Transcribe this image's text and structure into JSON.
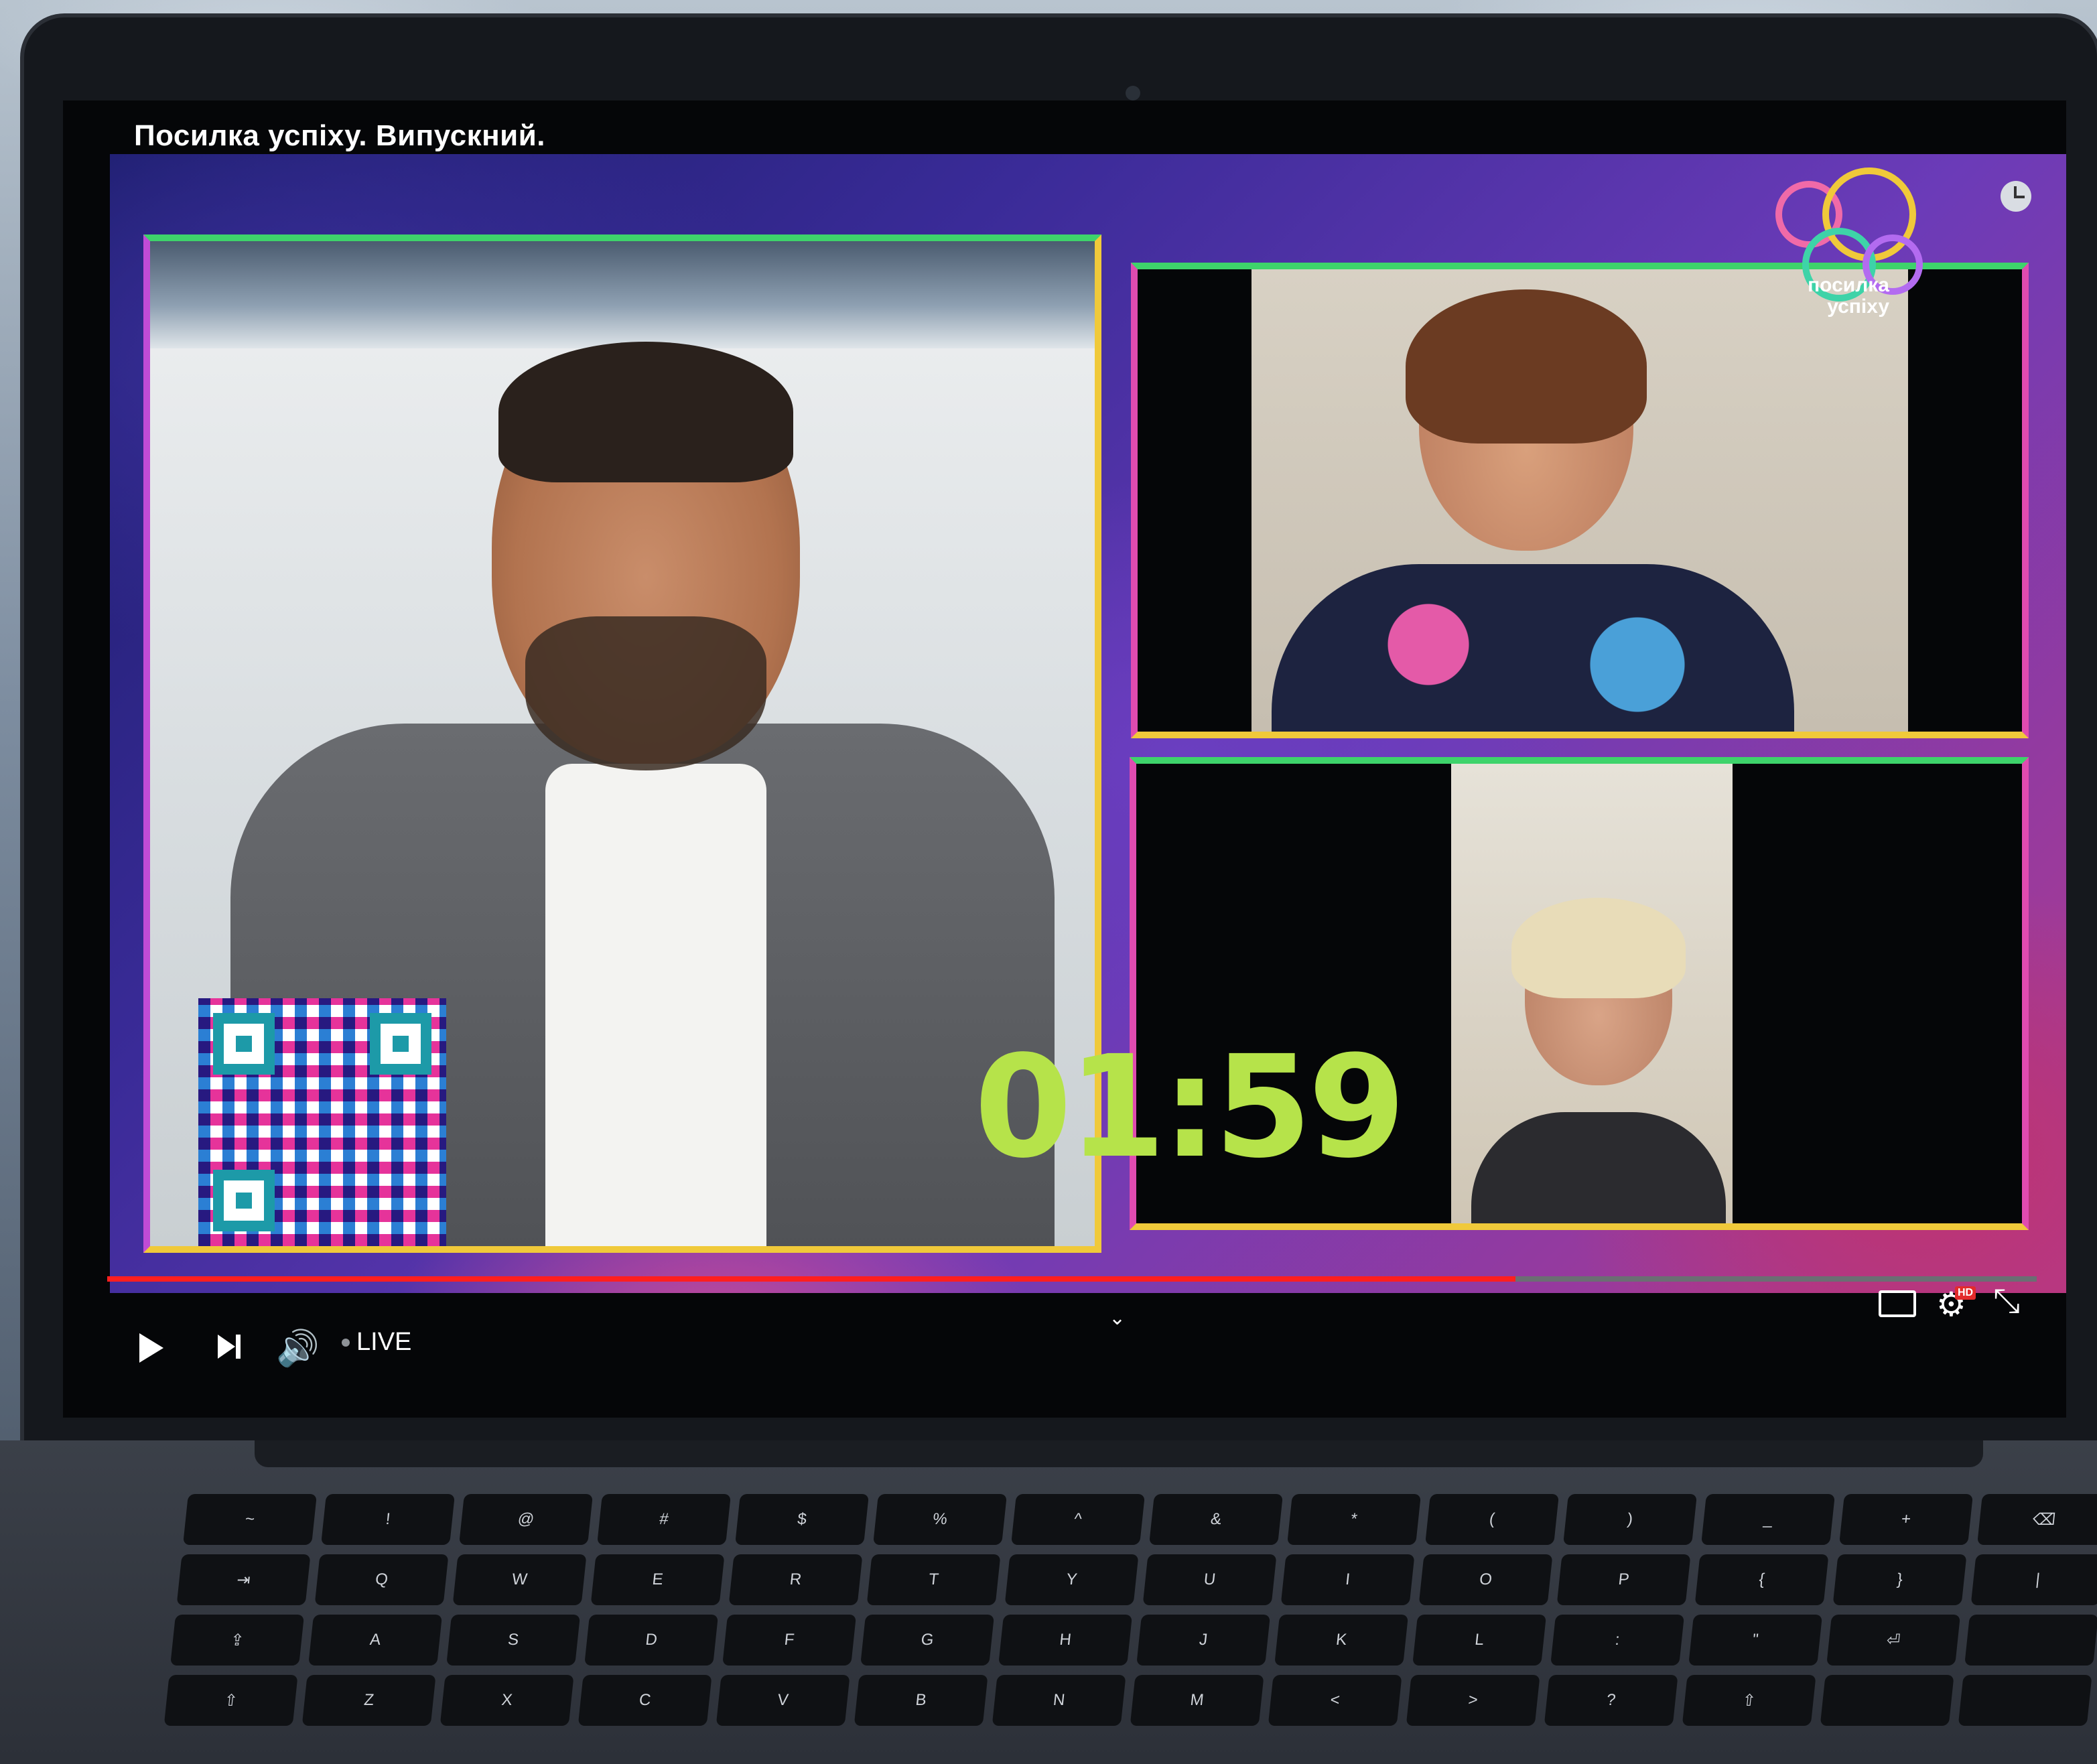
{
  "player": {
    "title": "Посилка успіху. Випускний.",
    "timer": "01:59",
    "live_label": "LIVE",
    "progress_fraction": 0.73,
    "accent_color": "#ff1f1f",
    "timer_color": "#b6e34a",
    "hd_badge": "HD"
  },
  "logo": {
    "line1": "посилка",
    "line2": "успіху"
  },
  "icons": {
    "play": "play-icon",
    "next": "next-icon",
    "volume": "volume-icon",
    "chevron": "chevron-down-icon",
    "keyboard": "keyboard-icon",
    "settings": "gear-icon",
    "fullscreen": "exit-fullscreen-icon",
    "clock": "clock-icon"
  },
  "keyboard": {
    "row1": [
      "~",
      "!",
      "@",
      "#",
      "$",
      "%",
      "^",
      "&",
      "*",
      "(",
      ")",
      "_",
      "+",
      "⌫"
    ],
    "row2": [
      "⇥",
      "Q",
      "W",
      "E",
      "R",
      "T",
      "Y",
      "U",
      "I",
      "O",
      "P",
      "{",
      "}",
      "|"
    ],
    "row3": [
      "⇪",
      "A",
      "S",
      "D",
      "F",
      "G",
      "H",
      "J",
      "K",
      "L",
      ":",
      "\"",
      "⏎",
      ""
    ],
    "row4": [
      "⇧",
      "Z",
      "X",
      "C",
      "V",
      "B",
      "N",
      "M",
      "<",
      ">",
      "?",
      "⇧",
      "",
      ""
    ]
  }
}
